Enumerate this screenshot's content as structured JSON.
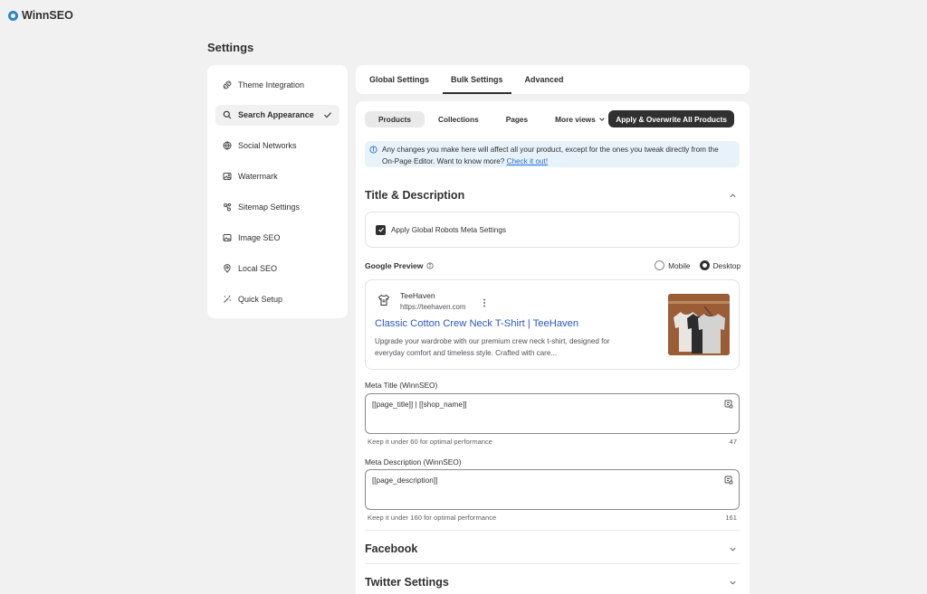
{
  "brand": {
    "name": "WinnSEO"
  },
  "page": {
    "title": "Settings"
  },
  "sidebar": {
    "items": [
      {
        "label": "Theme Integration",
        "icon": "plug-icon"
      },
      {
        "label": "Search Appearance",
        "icon": "search-icon",
        "active": true
      },
      {
        "label": "Social Networks",
        "icon": "globe-icon"
      },
      {
        "label": "Watermark",
        "icon": "image-icon"
      },
      {
        "label": "Sitemap Settings",
        "icon": "sitemap-icon"
      },
      {
        "label": "Image SEO",
        "icon": "image-seo-icon"
      },
      {
        "label": "Local SEO",
        "icon": "location-pin-icon"
      },
      {
        "label": "Quick Setup",
        "icon": "magic-wand-icon"
      }
    ]
  },
  "tabs": [
    {
      "label": "Global Settings"
    },
    {
      "label": "Bulk Settings",
      "active": true
    },
    {
      "label": "Advanced"
    }
  ],
  "subtabs": {
    "items": [
      "Products",
      "Collections",
      "Pages",
      "More views"
    ],
    "active": "Products",
    "apply_label": "Apply & Overwrite All Products"
  },
  "info": {
    "text": "Any changes you make here will affect all your product, except for the ones you tweak directly from the On-Page Editor. Want to know more?",
    "link": "Check it out!"
  },
  "title_desc": {
    "heading": "Title & Description",
    "robots_label": "Apply Global Robots Meta Settings",
    "robots_checked": true
  },
  "google_preview": {
    "label": "Google Preview",
    "modes": [
      "Mobile",
      "Desktop"
    ],
    "selected": "Desktop",
    "site_name": "TeeHaven",
    "url": "https://teehaven.com",
    "title": "Classic Cotton Crew Neck T-Shirt | TeeHaven",
    "description": "Upgrade your wardrobe with our premium crew neck t-shirt, designed for everyday comfort and timeless style. Crafted with care..."
  },
  "meta_title": {
    "label": "Meta Title (WinnSEO)",
    "value": "[[page_title]] |  [[shop_name]]",
    "hint": "Keep it under 60 for optimal performance",
    "count": "47"
  },
  "meta_description": {
    "label": "Meta Description (WinnSEO)",
    "value": "[[page_description]]",
    "hint": "Keep it under 160 for optimal performance",
    "count": "161"
  },
  "sections": {
    "facebook": "Facebook",
    "twitter": "Twitter Settings"
  },
  "colors": {
    "accent_dark": "#303030",
    "link_blue": "#2a58c2",
    "banner_bg": "#e8f2fb",
    "brand_blue": "#2b86c5"
  }
}
